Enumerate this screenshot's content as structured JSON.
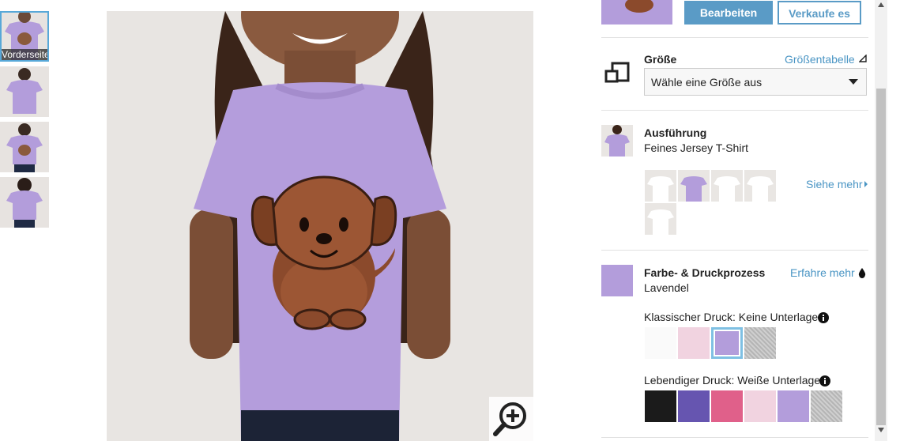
{
  "thumbnails": {
    "active_label": "Vorderseite"
  },
  "top_buttons": {
    "edit": "Bearbeiten",
    "sell": "Verkaufe es"
  },
  "size": {
    "title": "Größe",
    "chart_link": "Größentabelle",
    "select_value": "Wähle eine Größe aus"
  },
  "style": {
    "title": "Ausführung",
    "value": "Feines Jersey T-Shirt",
    "see_more": "Siehe mehr"
  },
  "color": {
    "title": "Farbe- & Druckprozess",
    "learn_more": "Erfahre mehr",
    "value": "Lavendel",
    "classic_label": "Klassischer Druck: Keine Unterlage",
    "vivid_label": "Lebendiger Druck: Weiße Unterlage",
    "classic_swatches": [
      "#fafafa",
      "#f1d3e0",
      "#b39ddb",
      "#bdbdbd"
    ],
    "vivid_swatches": [
      "#1b1b1b",
      "#6655b0",
      "#e0608a",
      "#f1d3e0",
      "#b39ddb",
      "#bdbdbd"
    ]
  },
  "colors": {
    "accent": "#58a8d8",
    "link": "#4a95c4",
    "lavender": "#b39ddb"
  }
}
